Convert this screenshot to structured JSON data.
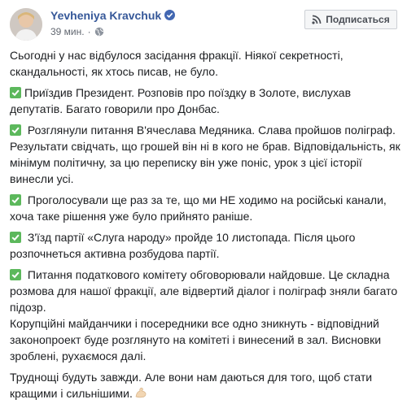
{
  "post": {
    "author": "Yevheniya Kravchuk",
    "time": "39 мин.",
    "dot": "·",
    "subscribe_label": "Подписаться",
    "paragraphs": [
      {
        "check": false,
        "text": "Сьогодні у нас відбулося засідання фракції. Ніякої секретності, скандальності, як хтось писав, не було."
      },
      {
        "check": true,
        "text": "Приїздив Президент. Розповів про поїздку в Золоте, вислухав депутатів. Багато говорили про Донбас."
      },
      {
        "check": true,
        "text": " Розглянули питання В'ячеслава Медяника. Слава пройшов поліграф. Результати свідчать, що грошей він ні в кого не брав. Відповідальність, як мінімум політичну, за цю переписку він уже поніс, урок з цієї історії винесли усі."
      },
      {
        "check": true,
        "text": " Проголосували ще раз за те, що ми НЕ ходимо на російські канали, хоча таке рішення уже було прийнято раніше."
      },
      {
        "check": true,
        "text": " З'їзд партії «Слуга народу» пройде 10 листопада. Після цього розпочнеться активна розбудова партії."
      },
      {
        "check": true,
        "text": " Питання податкового комітету обговорювали найдовше. Це складна розмова для нашої фракції, але відвертий діалог і поліграф зняли багато підозр.\nКорупційні майданчики і посередники все одно зникнуть - відповідний законопроект буде розглянуто на комітеті і винесений в зал. Висновки зроблені, рухаємося далі."
      },
      {
        "check": false,
        "text": "Труднощі будуть завжди. Але вони нам даються для того, щоб стати кращими і сильнішими.",
        "muscle": true
      }
    ]
  },
  "colors": {
    "link": "#365899",
    "check": "#5cb85c",
    "verified": "#4267b2"
  },
  "icons": [
    "avatar",
    "verified-badge-icon",
    "globe-icon",
    "rss-icon",
    "check-mark-icon",
    "flexed-biceps-icon"
  ]
}
